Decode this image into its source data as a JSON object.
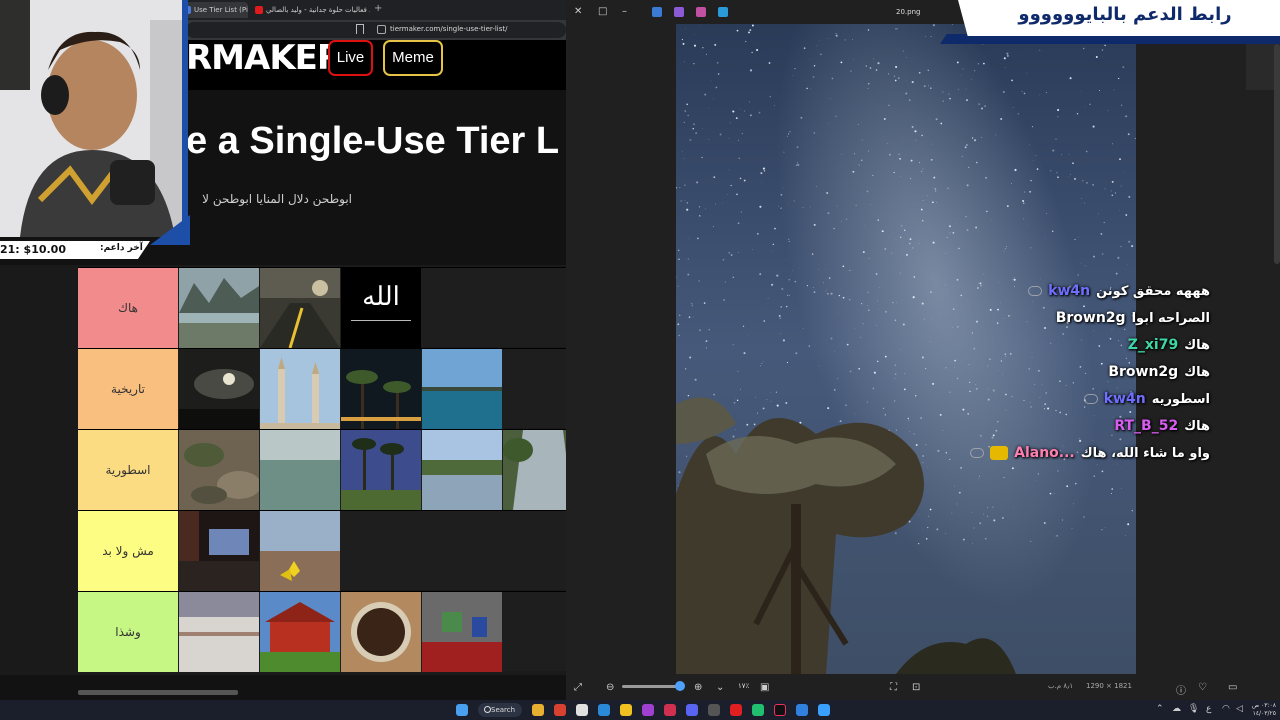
{
  "browser": {
    "tabs": [
      {
        "label": "Use Tier List (Pic"
      },
      {
        "label": "تنفيذ فعاليات حلوة جدانية - وليد بالصالي"
      }
    ],
    "url": "tiermaker.com/single-use-tier-list/"
  },
  "tiermaker": {
    "logo_text": "RMAKER",
    "nav": {
      "live_label": "Live",
      "meme_label": "Meme"
    },
    "title": "e a Single-Use Tier L",
    "description": "ابوطحن دلال المنايا ابوطحن لا"
  },
  "tiers": [
    {
      "label": "هاك",
      "color": "#f28c8c",
      "images": [
        "mountain-lake",
        "rainy-street",
        "calligraphy"
      ]
    },
    {
      "label": "تاريخية",
      "color": "#f9bf7f",
      "images": [
        "night-moon",
        "mosque-minarets",
        "palm-night",
        "sea-coast"
      ]
    },
    {
      "label": "اسطورية",
      "color": "#fbdc82",
      "images": [
        "rocky-plants",
        "calm-sea",
        "palm-garden",
        "river",
        "waterfall"
      ]
    },
    {
      "label": "مش ولا بد",
      "color": "#fdfd84",
      "images": [
        "cinema-screen",
        "yellow-flower"
      ]
    },
    {
      "label": "وشذا",
      "color": "#c6f784",
      "images": [
        "snowy-field",
        "minecraft-house",
        "coffee-cup",
        "minecraft-room"
      ]
    }
  ],
  "calligraphy_text": "الله",
  "stream": {
    "support_banner": "رابط الدعم بالبايوووووو",
    "last_supporter_label": "آخر داعم:",
    "last_supporter_amount": "21: $10.00"
  },
  "viewer": {
    "filename": "20.png",
    "zoom": "١٧٪",
    "dimensions": "1290 × 1821",
    "filesize": "٨٫١ م.ب"
  },
  "chat": [
    {
      "user": "kw4n",
      "color": "#6f6fff",
      "message": "هههه محقق كونن",
      "badge": true
    },
    {
      "user": "Brown2g",
      "color": "#ffffff",
      "message": "الصراحه ابوا",
      "badge": false
    },
    {
      "user": "Z_xi79",
      "color": "#3fd6a6",
      "message": "هاك",
      "badge": false
    },
    {
      "user": "Brown2g",
      "color": "#ffffff",
      "message": "هاك",
      "badge": false
    },
    {
      "user": "kw4n",
      "color": "#6f6fff",
      "message": "اسطوريه",
      "badge": true
    },
    {
      "user": "RT_B_52",
      "color": "#d85cf0",
      "message": "هاك",
      "badge": false
    },
    {
      "user": "Alano...",
      "color": "#ff7fb0",
      "message": "واو ما شاء الله، هاك",
      "badge": true,
      "crown": true
    }
  ],
  "taskbar": {
    "search_label": "Search",
    "clock_time": "٠٣:٠٨ ص",
    "clock_date": "١٤/٠٣/٢٥"
  }
}
